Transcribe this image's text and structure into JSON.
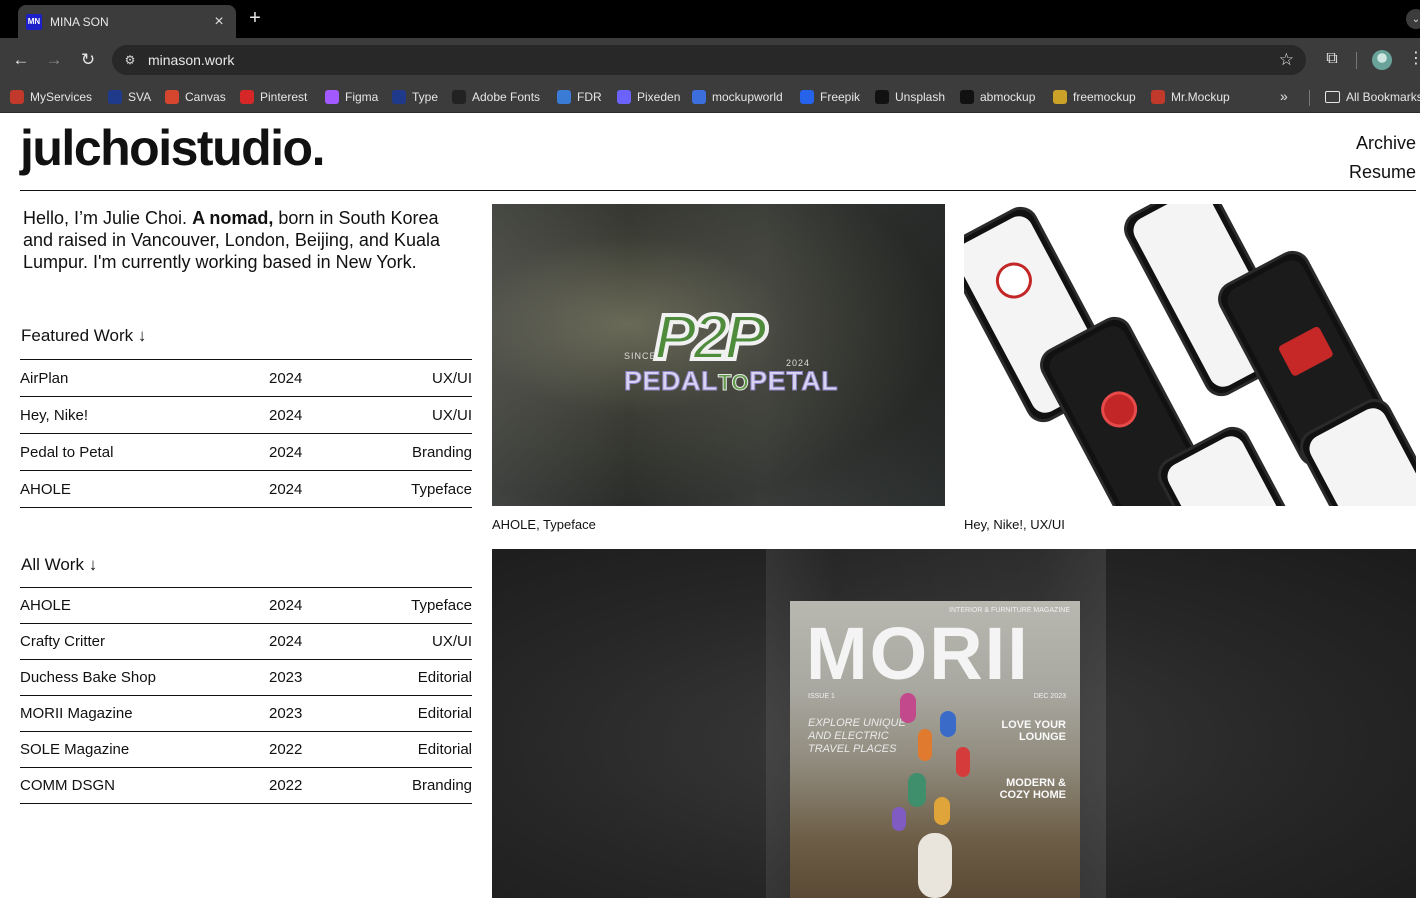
{
  "browser": {
    "tab_title": "MINA SON",
    "tab_favicon_text": "MN",
    "url": "minason.work",
    "bookmarks": [
      {
        "label": "MyServices",
        "color": "#c0392b"
      },
      {
        "label": "SVA",
        "color": "#1f3a8a"
      },
      {
        "label": "Canvas",
        "color": "#d6452d"
      },
      {
        "label": "Pinterest",
        "color": "#d52727"
      },
      {
        "label": "Figma",
        "color": "#a259ff"
      },
      {
        "label": "Type",
        "color": "#1f3a8a"
      },
      {
        "label": "Adobe Fonts",
        "color": "#222222"
      },
      {
        "label": "FDR",
        "color": "#3a7bd5"
      },
      {
        "label": "Pixeden",
        "color": "#6c63ff"
      },
      {
        "label": "mockupworld",
        "color": "#3c6edc"
      },
      {
        "label": "Freepik",
        "color": "#2563eb"
      },
      {
        "label": "Unsplash",
        "color": "#111111"
      },
      {
        "label": "abmockup",
        "color": "#111111"
      },
      {
        "label": "freemockup",
        "color": "#c9a227"
      },
      {
        "label": "Mr.Mockup",
        "color": "#c0392b"
      }
    ],
    "all_bookmarks_label": "All Bookmarks"
  },
  "site": {
    "logo": "julchoistudio.",
    "nav": [
      "Archive",
      "Resume"
    ],
    "intro_part1": "Hello, I’m Julie Choi. ",
    "intro_bold": "A nomad,",
    "intro_part2": " born in South Korea and raised in Vancouver, London, Beijing, and Kuala Lumpur. I'm currently working based in New York.",
    "featured_title": "Featured Work ↓",
    "featured": [
      {
        "name": "AirPlan",
        "year": "2024",
        "category": "UX/UI"
      },
      {
        "name": "Hey, Nike!",
        "year": "2024",
        "category": "UX/UI"
      },
      {
        "name": "Pedal to Petal",
        "year": "2024",
        "category": "Branding"
      },
      {
        "name": "AHOLE",
        "year": "2024",
        "category": "Typeface"
      }
    ],
    "all_title": "All Work ↓",
    "all": [
      {
        "name": "AHOLE",
        "year": "2024",
        "category": "Typeface"
      },
      {
        "name": "Crafty Critter",
        "year": "2024",
        "category": "UX/UI"
      },
      {
        "name": "Duchess Bake Shop",
        "year": "2023",
        "category": "Editorial"
      },
      {
        "name": "MORII Magazine",
        "year": "2023",
        "category": "Editorial"
      },
      {
        "name": "SOLE Magazine",
        "year": "2022",
        "category": "Editorial"
      },
      {
        "name": "COMM DSGN",
        "year": "2022",
        "category": "Branding"
      }
    ],
    "thumbs": {
      "pedal": {
        "caption": "AHOLE, Typeface",
        "logo": "P2P",
        "since": "SINCE",
        "year": "2024",
        "word_a": "PEDAL",
        "word_to": "TO",
        "word_b": "PETAL"
      },
      "nike": {
        "caption": "Hey, Nike!, UX/UI"
      },
      "morii": {
        "title": "MORII",
        "tag": "INTERIOR & FURNITURE MAGAZINE",
        "issue": "ISSUE 1",
        "date": "DEC 2023",
        "tagline": "EXPLORE UNIQUE AND ELECTRIC TRAVEL PLACES",
        "head1": "LOVE YOUR LOUNGE",
        "head2": "MODERN & COZY HOME"
      }
    }
  }
}
